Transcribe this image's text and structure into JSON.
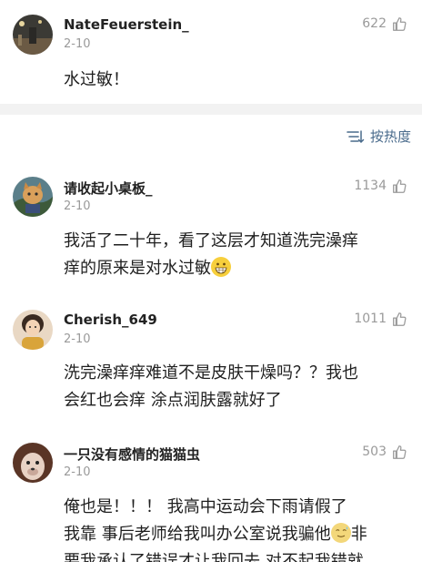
{
  "comments": [
    {
      "username": "NateFeuerstein_",
      "date": "2-10",
      "likes": "622",
      "text_lines": [
        "水过敏！"
      ]
    },
    {
      "username": "请收起小桌板_",
      "date": "2-10",
      "likes": "1134",
      "text_lines": [
        "我活了二十年，看了这层才知道洗完澡痒",
        "痒的原来是对水过敏"
      ]
    },
    {
      "username": "Cherish_649",
      "date": "2-10",
      "likes": "1011",
      "text_lines": [
        "洗完澡痒痒难道不是皮肤干燥吗？？我也",
        "会红也会痒  涂点润肤露就好了"
      ]
    },
    {
      "username": "一只没有感情的猫猫虫",
      "date": "2-10",
      "likes": "503",
      "text_lines": [
        "俺也是！！！  我高中运动会下雨请假了",
        "我靠  事后老师给我叫办公室说我骗他",
        "非",
        "要我承认了错误才让我回去  对不起我错就"
      ]
    }
  ],
  "sort": {
    "label": "按热度",
    "icon": "sort-lines-icon"
  },
  "icons": {
    "like": "thumbs-up-icon",
    "emoji_grin": "grinning-emoji",
    "emoji_sweat": "awkward-smile-emoji"
  },
  "colors": {
    "meta": "#9a9a9a",
    "sort_accent": "#4a6b8c",
    "separator": "#f2f2f2"
  }
}
